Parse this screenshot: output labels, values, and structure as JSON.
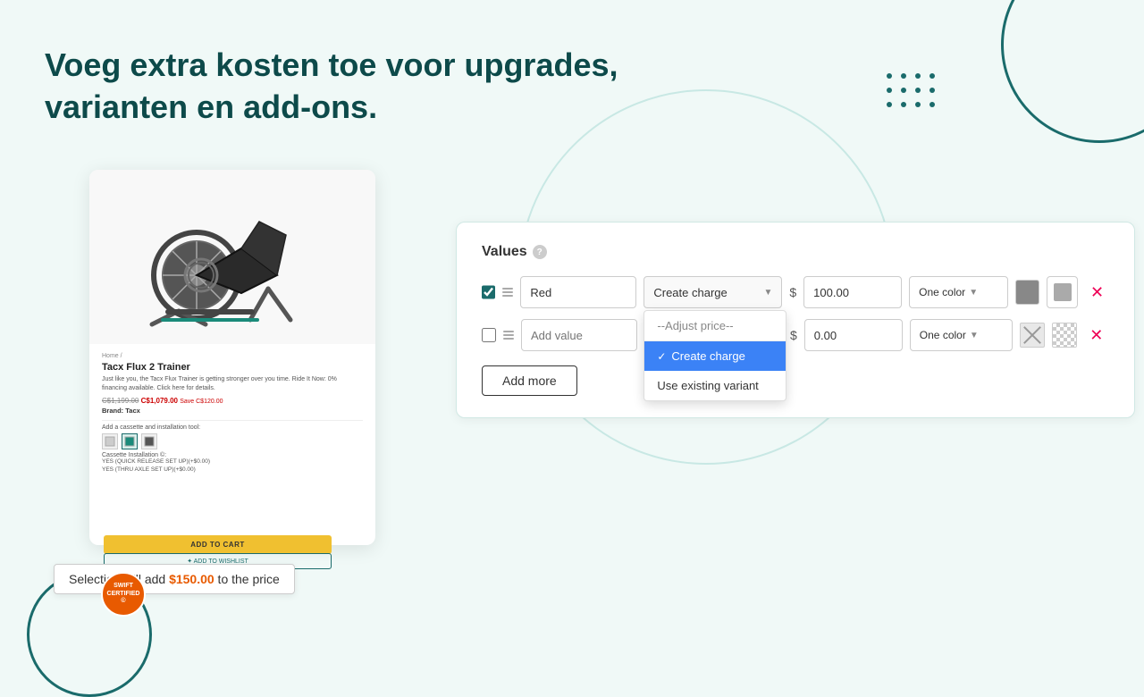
{
  "heading": {
    "line1": "Voeg extra kosten toe voor upgrades,",
    "line2": "varianten en add-ons."
  },
  "panel": {
    "title": "Values",
    "help_icon": "?",
    "add_more_label": "Add more"
  },
  "rows": [
    {
      "id": "row1",
      "checked": true,
      "value": "Red",
      "charge_type": "Create charge",
      "price": "100.00",
      "color_label": "One color",
      "swatch_color": "#888888",
      "picker_color": "#aaaaaa"
    },
    {
      "id": "row2",
      "checked": false,
      "value": "",
      "value_placeholder": "Add value",
      "charge_type": "Create charge",
      "price": "0.00",
      "color_label": "One color",
      "swatch_color": null,
      "picker_color": null
    }
  ],
  "dropdown": {
    "items": [
      {
        "label": "--Adjust price--",
        "type": "separator",
        "selected": false
      },
      {
        "label": "Create charge",
        "type": "option",
        "selected": true
      },
      {
        "label": "Use existing variant",
        "type": "option",
        "selected": false
      }
    ]
  },
  "price_badge": {
    "prefix": "Selection will add ",
    "amount": "$150.00",
    "suffix": " to the price"
  },
  "product": {
    "breadcrumb": "Home /",
    "title": "Tacx Flux 2 Trainer",
    "description": "Just like you, the Tacx Flux Trainer is getting stronger over you time. Ride It Now: 0% financing available. Click here for details.",
    "price_original": "C$1,199.00",
    "price_current": "C$1,079.00",
    "save_text": "Save C$120.00",
    "brand_label": "Brand:",
    "brand_name": "Tacx",
    "addon_label": "Add a cassette and installation tool:",
    "addon_options": [
      "icon1",
      "icon2",
      "icon3"
    ],
    "cassette_label": "Cassette Installation ©:",
    "cassette_option1": "YES (QUICK RELEASE SET UP)(+$0.00)",
    "cassette_option2": "YES (THRU AXLE SET UP)(+$0.00)",
    "add_to_cart": "ADD TO CART",
    "wishlist": "✦ ADD TO WISHLIST",
    "badge_line1": "SWIFT",
    "badge_line2": "CERTIFIED",
    "badge_sym": "©"
  }
}
